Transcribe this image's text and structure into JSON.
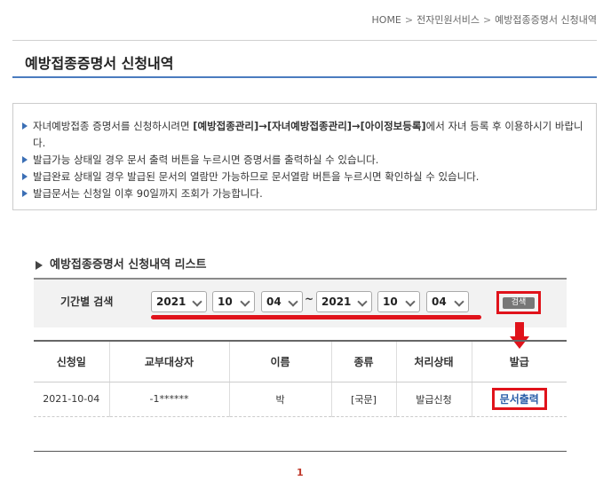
{
  "breadcrumb": [
    "HOME",
    "전자민원서비스",
    "예방접종증명서 신청내역"
  ],
  "page_title": "예방접종증명서 신청내역",
  "notices": [
    {
      "pre": "자녀예방접종 증명서를 신청하시려면 ",
      "bold": "[예방접종관리]→[자녀예방접종관리]→[아이정보등록]",
      "post": "에서 자녀 등록 후 이용하시기 바랍니다."
    },
    {
      "pre": "발급가능 상태일 경우 문서 출력 버튼을 누르시면 증명서를 출력하실 수 있습니다.",
      "bold": "",
      "post": ""
    },
    {
      "pre": "발급완료 상태일 경우 발급된 문서의 열람만 가능하므로 문서열람 버튼을 누르시면 확인하실 수 있습니다.",
      "bold": "",
      "post": ""
    },
    {
      "pre": "발급문서는 신청일 이후 90일까지 조회가 가능합니다.",
      "bold": "",
      "post": ""
    }
  ],
  "list_title": "예방접종증명서 신청내역 리스트",
  "search": {
    "label": "기간별 검색",
    "from": {
      "year": "2021",
      "month": "10",
      "day": "04"
    },
    "tilde": "~",
    "to": {
      "year": "2021",
      "month": "10",
      "day": "04"
    },
    "button": "검색"
  },
  "table": {
    "headers": [
      "신청일",
      "교부대상자",
      "이름",
      "종류",
      "처리상태",
      "발급"
    ],
    "rows": [
      {
        "date": "2021-10-04",
        "target": "-1******",
        "name": "박",
        "type": "[국문]",
        "status": "발급신청",
        "action": "문서출력"
      }
    ]
  },
  "pagination": {
    "current": "1"
  },
  "colors": {
    "accent_red": "#e0131b",
    "link_blue": "#2a5ea8",
    "title_underline": "#4a7cbf"
  }
}
